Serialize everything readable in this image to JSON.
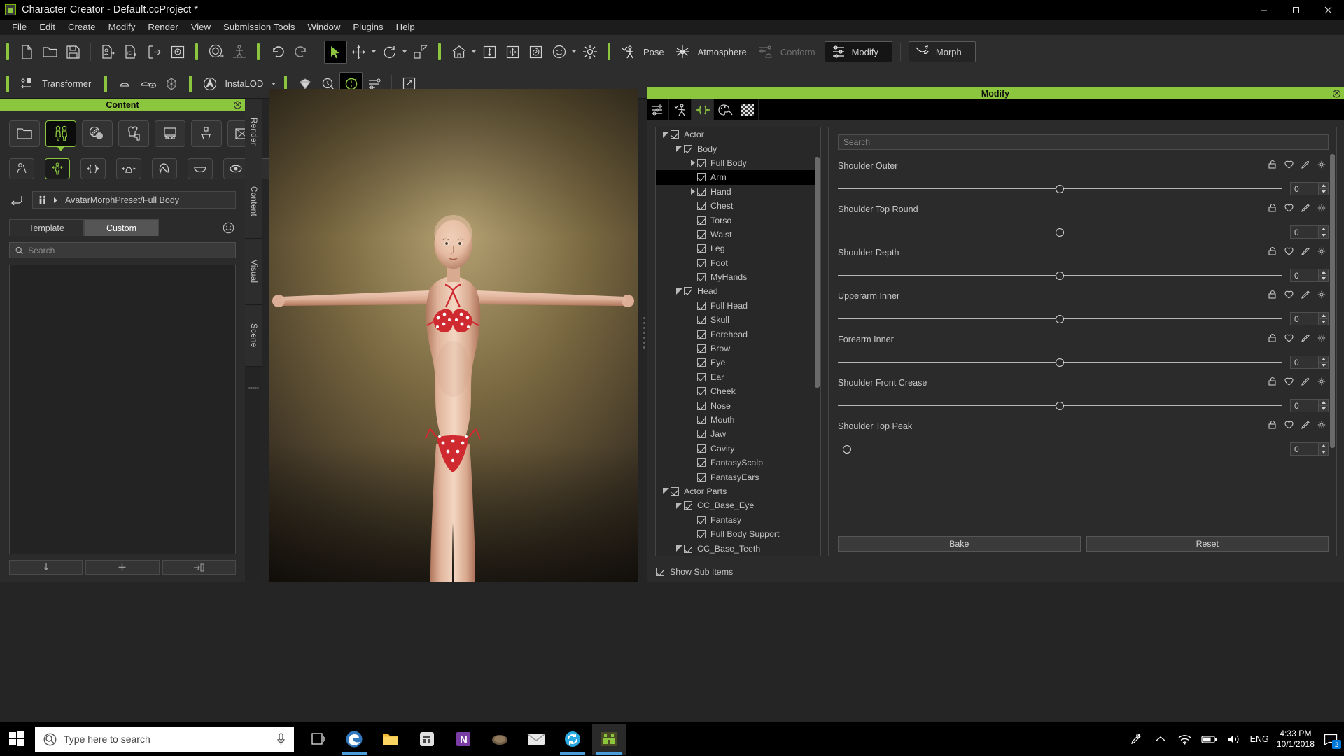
{
  "window": {
    "title": "Character Creator - Default.ccProject *",
    "app_icon": "character-creator-icon",
    "minimize": "minimize",
    "maximize": "maximize",
    "close": "close"
  },
  "menu": {
    "items": [
      "File",
      "Edit",
      "Create",
      "Modify",
      "Render",
      "View",
      "Submission Tools",
      "Window",
      "Plugins",
      "Help"
    ]
  },
  "toolbar_main": {
    "file_group": [
      "new-project-icon",
      "open-project-icon",
      "save-project-icon"
    ],
    "io_group": [
      "import-character-icon",
      "import-icon-icon",
      "export-icon",
      "export-render-icon"
    ],
    "transform_group": [
      "gizmo-object-icon",
      "gizmo-pose-icon"
    ],
    "history_group": [
      "undo-icon",
      "redo-icon"
    ],
    "select_group": [
      "select-tool-icon",
      "move-tool-icon",
      "rotate-tool-icon",
      "scale-tool-icon"
    ],
    "view_group": [
      "home-view-icon",
      "fit-vertical-icon",
      "fit-all-icon",
      "fit-object-icon",
      "face-view-icon",
      "light-icon"
    ],
    "pose_label": "Pose",
    "pose_icon": "pose-icon",
    "atmosphere_label": "Atmosphere",
    "atmosphere_icon": "atmosphere-icon",
    "conform_label": "Conform",
    "conform_icon": "conform-icon",
    "modify_label": "Modify",
    "modify_icon": "modify-icon",
    "morph_label": "Morph",
    "morph_icon": "morph-icon"
  },
  "toolbar_second": {
    "transformer_label": "Transformer",
    "transformer_icon": "transformer-icon",
    "tools": [
      "smooth-icon",
      "smooth-eye-icon",
      "mesh-icon"
    ],
    "instalod_label": "InstaLOD",
    "instalod_icon": "instalod-icon",
    "extras": [
      "gem-icon",
      "search-scene-icon",
      "appearance-editor-icon",
      "layer-icon",
      "popup-icon"
    ]
  },
  "content_panel": {
    "title": "Content",
    "close_icon": "close-icon",
    "categories": [
      {
        "name": "folder",
        "icon": "folder-icon",
        "selected": false
      },
      {
        "name": "character",
        "icon": "character-icon",
        "selected": true
      },
      {
        "name": "material",
        "icon": "material-icon",
        "selected": false
      },
      {
        "name": "cloth",
        "icon": "cloth-icon",
        "selected": false
      },
      {
        "name": "prop",
        "icon": "prop-icon",
        "selected": false
      },
      {
        "name": "scene",
        "icon": "scene-icon",
        "selected": false
      },
      {
        "name": "camera",
        "icon": "camera-icon",
        "selected": false
      }
    ],
    "subcategories": [
      {
        "name": "avatar",
        "icon": "avatar-icon",
        "selected": false
      },
      {
        "name": "full-body-morph",
        "icon": "full-body-morph-icon",
        "selected": true
      },
      {
        "name": "body-part-morph",
        "icon": "body-part-morph-icon",
        "selected": false
      },
      {
        "name": "head-morph",
        "icon": "head-morph-icon",
        "selected": false
      },
      {
        "name": "hair",
        "icon": "hair-icon",
        "selected": false
      },
      {
        "name": "eyelash",
        "icon": "eyelash-icon",
        "selected": false
      },
      {
        "name": "eye",
        "icon": "eye-icon",
        "selected": false
      },
      {
        "name": "extra-1",
        "icon": "extra-slot-icon",
        "selected": false
      },
      {
        "name": "extra-2",
        "icon": "extra-slot-icon",
        "selected": false
      }
    ],
    "back_icon": "back-arrow-icon",
    "path_icon": "character-small-icon",
    "path_arrow": "chevron-right-icon",
    "path": "AvatarMorphPreset/Full Body",
    "tabs": [
      {
        "label": "Template",
        "active": false
      },
      {
        "label": "Custom",
        "active": true
      }
    ],
    "tab_settings_icon": "smiley-settings-icon",
    "search_placeholder": "Search",
    "search_value": "",
    "search_icon": "search-icon",
    "footer_buttons": [
      {
        "name": "load",
        "icon": "down-arrow-icon"
      },
      {
        "name": "add",
        "icon": "plus-icon"
      },
      {
        "name": "apply",
        "icon": "apply-icon"
      }
    ]
  },
  "dock_tabs": [
    {
      "label": "Render"
    },
    {
      "label": "Content"
    },
    {
      "label": "Visual"
    },
    {
      "label": "Scene"
    }
  ],
  "viewport": {
    "name": "3d-viewport",
    "subject": "female-avatar-t-pose",
    "background_colors": [
      "#6b5a3e",
      "#9c8a63",
      "#3a3226",
      "#241d14"
    ]
  },
  "modify_panel": {
    "title": "Modify",
    "close_icon": "close-icon",
    "tabs": [
      {
        "name": "attributes",
        "icon": "sliders-icon",
        "active": false
      },
      {
        "name": "pose",
        "icon": "pose-icon",
        "active": false
      },
      {
        "name": "morph",
        "icon": "morph-constrain-icon",
        "active": true
      },
      {
        "name": "material",
        "icon": "palette-icon",
        "active": false
      },
      {
        "name": "texture",
        "icon": "checker-icon",
        "active": false
      }
    ],
    "tree": [
      {
        "label": "Actor",
        "depth": 0,
        "arrow": "down",
        "checked": true,
        "selected": false
      },
      {
        "label": "Body",
        "depth": 1,
        "arrow": "down",
        "checked": true,
        "selected": false
      },
      {
        "label": "Full Body",
        "depth": 2,
        "arrow": "right",
        "checked": true,
        "selected": false
      },
      {
        "label": "Arm",
        "depth": 2,
        "arrow": "none",
        "checked": true,
        "selected": true
      },
      {
        "label": "Hand",
        "depth": 2,
        "arrow": "right",
        "checked": true,
        "selected": false
      },
      {
        "label": "Chest",
        "depth": 2,
        "arrow": "none",
        "checked": true,
        "selected": false
      },
      {
        "label": "Torso",
        "depth": 2,
        "arrow": "none",
        "checked": true,
        "selected": false
      },
      {
        "label": "Waist",
        "depth": 2,
        "arrow": "none",
        "checked": true,
        "selected": false
      },
      {
        "label": "Leg",
        "depth": 2,
        "arrow": "none",
        "checked": true,
        "selected": false
      },
      {
        "label": "Foot",
        "depth": 2,
        "arrow": "none",
        "checked": true,
        "selected": false
      },
      {
        "label": "MyHands",
        "depth": 2,
        "arrow": "none",
        "checked": true,
        "selected": false
      },
      {
        "label": "Head",
        "depth": 1,
        "arrow": "down",
        "checked": true,
        "selected": false
      },
      {
        "label": "Full Head",
        "depth": 2,
        "arrow": "none",
        "checked": true,
        "selected": false
      },
      {
        "label": "Skull",
        "depth": 2,
        "arrow": "none",
        "checked": true,
        "selected": false
      },
      {
        "label": "Forehead",
        "depth": 2,
        "arrow": "none",
        "checked": true,
        "selected": false
      },
      {
        "label": "Brow",
        "depth": 2,
        "arrow": "none",
        "checked": true,
        "selected": false
      },
      {
        "label": "Eye",
        "depth": 2,
        "arrow": "none",
        "checked": true,
        "selected": false
      },
      {
        "label": "Ear",
        "depth": 2,
        "arrow": "none",
        "checked": true,
        "selected": false
      },
      {
        "label": "Cheek",
        "depth": 2,
        "arrow": "none",
        "checked": true,
        "selected": false
      },
      {
        "label": "Nose",
        "depth": 2,
        "arrow": "none",
        "checked": true,
        "selected": false
      },
      {
        "label": "Mouth",
        "depth": 2,
        "arrow": "none",
        "checked": true,
        "selected": false
      },
      {
        "label": "Jaw",
        "depth": 2,
        "arrow": "none",
        "checked": true,
        "selected": false
      },
      {
        "label": "Cavity",
        "depth": 2,
        "arrow": "none",
        "checked": true,
        "selected": false
      },
      {
        "label": "FantasyScalp",
        "depth": 2,
        "arrow": "none",
        "checked": true,
        "selected": false
      },
      {
        "label": "FantasyEars",
        "depth": 2,
        "arrow": "none",
        "checked": true,
        "selected": false
      },
      {
        "label": "Actor Parts",
        "depth": 0,
        "arrow": "down",
        "checked": true,
        "selected": false
      },
      {
        "label": "CC_Base_Eye",
        "depth": 1,
        "arrow": "down",
        "checked": true,
        "selected": false
      },
      {
        "label": "Fantasy",
        "depth": 2,
        "arrow": "none",
        "checked": true,
        "selected": false
      },
      {
        "label": "Full Body Support",
        "depth": 2,
        "arrow": "none",
        "checked": true,
        "selected": false
      },
      {
        "label": "CC_Base_Teeth",
        "depth": 1,
        "arrow": "down",
        "checked": true,
        "selected": false
      }
    ],
    "search_placeholder": "Search",
    "search_value": "",
    "sliders": [
      {
        "label": "Shoulder Outer",
        "value": "0",
        "knob_pct": 50
      },
      {
        "label": "Shoulder Top Round",
        "value": "0",
        "knob_pct": 50
      },
      {
        "label": "Shoulder Depth",
        "value": "0",
        "knob_pct": 50
      },
      {
        "label": "Upperarm Inner",
        "value": "0",
        "knob_pct": 50
      },
      {
        "label": "Forearm Inner",
        "value": "0",
        "knob_pct": 50
      },
      {
        "label": "Shoulder Front Crease",
        "value": "0",
        "knob_pct": 50
      },
      {
        "label": "Shoulder Top Peak",
        "value": "0",
        "knob_pct": 2
      }
    ],
    "slider_row_icons": [
      "lock-icon",
      "favorite-icon",
      "edit-icon",
      "settings-icon"
    ],
    "bake_label": "Bake",
    "reset_label": "Reset",
    "show_sub_items_label": "Show Sub Items",
    "show_sub_items_checked": true
  },
  "taskbar": {
    "start_icon": "windows-start-icon",
    "search_placeholder": "Type here to search",
    "search_icon": "search-circle-icon",
    "mic_icon": "microphone-icon",
    "task_view_icon": "task-view-icon",
    "pinned": [
      {
        "name": "edge",
        "icon": "edge-icon",
        "running": true
      },
      {
        "name": "file-explorer",
        "icon": "folder-icon",
        "running": false
      },
      {
        "name": "microsoft-store",
        "icon": "store-icon",
        "running": false
      },
      {
        "name": "onenote",
        "icon": "onenote-icon",
        "running": false
      },
      {
        "name": "media-player",
        "icon": "media-icon",
        "running": false
      },
      {
        "name": "mail",
        "icon": "mail-icon",
        "running": false
      },
      {
        "name": "sync",
        "icon": "sync-icon",
        "running": true
      },
      {
        "name": "character-creator",
        "icon": "character-creator-icon",
        "running": true
      }
    ],
    "tray": {
      "pen_icon": "pen-icon",
      "chevron_icon": "chevron-up-icon",
      "wifi_icon": "wifi-icon",
      "battery_icon": "battery-icon",
      "volume_icon": "volume-icon",
      "language": "ENG",
      "time": "4:33 PM",
      "date": "10/1/2018",
      "action_center_icon": "action-center-icon",
      "notification_count": "2"
    }
  },
  "colors": {
    "accent_green": "#8cc63e",
    "panel_bg": "#2b2b2b",
    "toolbar_bg": "#2d2d2d",
    "selection": "#000000",
    "taskbar_accent": "#0078d7"
  }
}
